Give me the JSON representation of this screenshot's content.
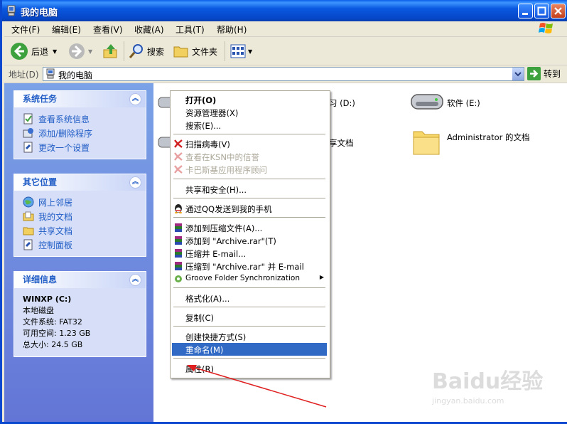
{
  "window": {
    "title": "我的电脑"
  },
  "menubar": [
    {
      "label": "文件(F)"
    },
    {
      "label": "编辑(E)"
    },
    {
      "label": "查看(V)"
    },
    {
      "label": "收藏(A)"
    },
    {
      "label": "工具(T)"
    },
    {
      "label": "帮助(H)"
    }
  ],
  "toolbar": {
    "back": "后退",
    "search": "搜索",
    "folders": "文件夹"
  },
  "address": {
    "label": "地址(D)",
    "value": "我的电脑",
    "go": "转到"
  },
  "left": {
    "system_tasks": {
      "title": "系统任务",
      "items": [
        "查看系统信息",
        "添加/删除程序",
        "更改一个设置"
      ]
    },
    "other_places": {
      "title": "其它位置",
      "items": [
        "网上邻居",
        "我的文档",
        "共享文档",
        "控制面板"
      ]
    },
    "details": {
      "title": "详细信息",
      "name": "WINXP (C:)",
      "type": "本地磁盘",
      "fs": "文件系统: FAT32",
      "free": "可用空间: 1.23 GB",
      "total": "总大小: 24.5 GB"
    }
  },
  "right": {
    "items": [
      "习 (D:)",
      "享文档",
      "软件 (E:)",
      "Administrator 的文档"
    ]
  },
  "context_menu": {
    "items": [
      "打开(O)",
      "资源管理器(X)",
      "搜索(E)...",
      "扫描病毒(V)",
      "查看在KSN中的信誉",
      "卡巴斯基应用程序顾问",
      "共享和安全(H)...",
      "通过QQ发送到我的手机",
      "添加到压缩文件(A)...",
      "添加到 \"Archive.rar\"(T)",
      "压缩并 E-mail...",
      "压缩到 \"Archive.rar\" 并 E-mail",
      "Groove Folder Synchronization",
      "格式化(A)...",
      "复制(C)",
      "创建快捷方式(S)",
      "重命名(M)",
      "属性(R)"
    ]
  },
  "watermark": {
    "brand": "Baidu经验",
    "url": "jingyan.baidu.com"
  },
  "colors": {
    "titlebar": "#0a58e0",
    "left_pane": "#6f8fe0",
    "selection": "#316ac5",
    "link": "#215dc6"
  }
}
